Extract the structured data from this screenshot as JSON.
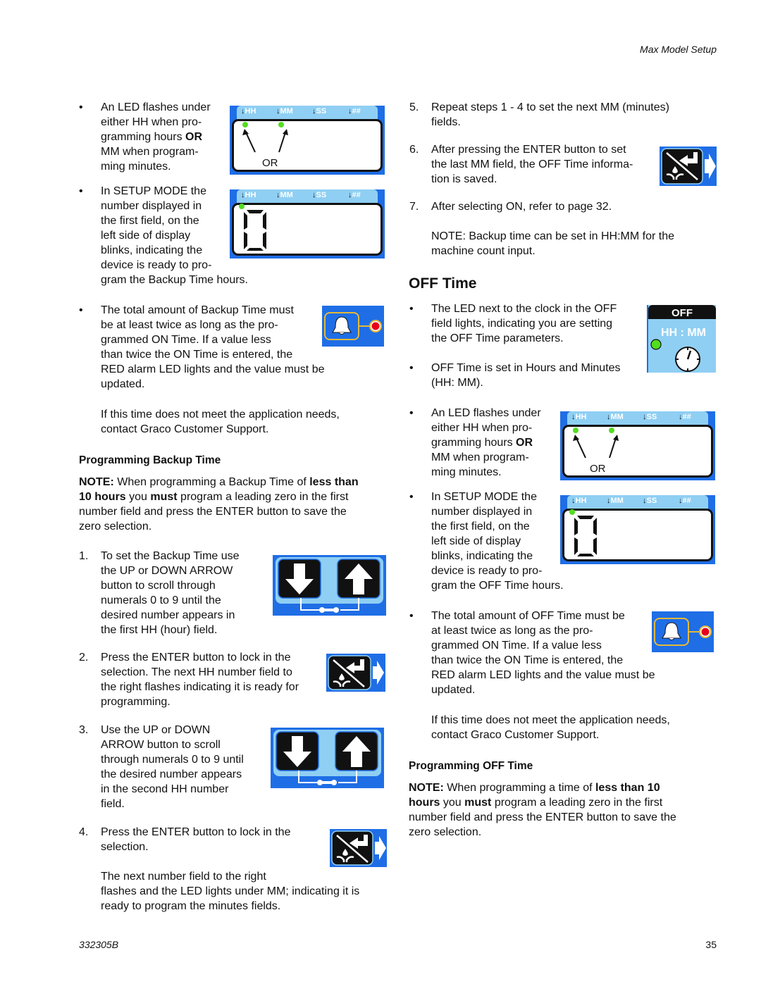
{
  "header": {
    "section": "Max Model Setup"
  },
  "footer": {
    "doc_number": "332305B",
    "page_number": "35"
  },
  "left": {
    "bullet1": {
      "lines": [
        "An LED flashes under",
        "either HH when pro-",
        "gramming hours ",
        "MM when program-",
        "ming minutes."
      ],
      "bold_or": "OR"
    },
    "bullet2": {
      "lines": [
        "In SETUP MODE the",
        "number displayed in",
        "the first field, on the",
        "left side of display",
        "blinks, indicating the",
        "device is ready to pro-",
        "gram the Backup Time hours."
      ]
    },
    "bullet3": {
      "lines": [
        "The total amount of Backup Time must",
        "be at least twice as long as the pro-",
        "grammed ON Time. If a value less",
        "than twice the ON Time is entered, the",
        "RED alarm LED lights and the value must be",
        "updated."
      ]
    },
    "contact_note": [
      "If this time does not meet the application needs,",
      "contact Graco Customer Support."
    ],
    "programming_heading": "Programming Backup Time",
    "note": {
      "label": "NOTE:",
      "t1": " When programming a Backup Time of ",
      "b1": "less than",
      "b2": "10 hours",
      "t2": " you ",
      "b3": "must",
      "t3": " program a leading zero in the first",
      "line3": "number field and press the ENTER button to save the",
      "line4": "zero selection."
    },
    "steps": [
      {
        "num": "1.",
        "lines": [
          "To set the Backup Time use",
          "the UP or DOWN ARROW",
          "button to scroll through",
          "numerals 0 to 9 until the",
          "desired number appears in",
          "the first HH (hour) field."
        ]
      },
      {
        "num": "2.",
        "lines": [
          "Press the ENTER button to lock in the",
          "selection. The next HH number field to",
          "the right flashes indicating it is ready for",
          "programming."
        ]
      },
      {
        "num": "3.",
        "lines": [
          "Use the UP or DOWN",
          "ARROW button to scroll",
          "through numerals 0 to 9 until",
          "the desired number appears",
          "in the second HH number",
          "field."
        ]
      },
      {
        "num": "4.",
        "lines": [
          "Press the ENTER button to lock in the",
          "selection."
        ]
      }
    ],
    "step4_followup": [
      "The next number field to the right",
      "flashes and the LED lights under MM; indicating it is",
      "ready to program the minutes fields."
    ]
  },
  "right": {
    "steps": [
      {
        "num": "5.",
        "lines": [
          "Repeat steps 1 - 4 to set the next MM (minutes)",
          "fields."
        ]
      },
      {
        "num": "6.",
        "lines": [
          "After pressing the ENTER button to set",
          "the last MM field, the OFF Time informa-",
          "tion is saved."
        ]
      },
      {
        "num": "7.",
        "lines": [
          "After selecting ON, refer to page 32."
        ]
      }
    ],
    "note_backup": [
      "NOTE: Backup time can be set in HH:MM for the",
      "machine count input."
    ],
    "off_heading": "OFF Time",
    "bullet1": {
      "lines": [
        "The LED next to the clock in the OFF",
        "field lights, indicating you are setting",
        "the OFF Time parameters."
      ]
    },
    "bullet2": {
      "lines": [
        "OFF Time is set in Hours and Minutes",
        "(HH: MM)."
      ]
    },
    "bullet3": {
      "lines": [
        "An LED flashes under",
        "either HH when pro-",
        "gramming hours ",
        "MM when program-",
        "ming minutes."
      ],
      "bold_or": "OR"
    },
    "bullet4": {
      "lines": [
        "In SETUP MODE the",
        "number displayed in",
        "the first field, on the",
        "left side of display",
        "blinks, indicating the",
        "device is ready to pro-",
        "gram the OFF Time hours."
      ]
    },
    "bullet5": {
      "lines": [
        "The total amount of OFF Time must be",
        "at least twice as long as the pro-",
        "grammed ON Time. If a value less",
        "than twice the ON Time is entered, the",
        "RED alarm LED lights and the value must be",
        "updated."
      ]
    },
    "contact_note": [
      "If this time does not meet the application needs,",
      "contact Graco Customer Support."
    ],
    "programming_heading": "Programming OFF Time",
    "note": {
      "label": "NOTE:",
      "t1": " When programming a time of ",
      "b1": "less than 10",
      "b2": "hours",
      "t2": " you ",
      "b3": "must",
      "t3": " program a leading zero in the first",
      "line3": "number field and press the ENTER button to save the",
      "line4": "zero selection."
    }
  },
  "display": {
    "labels": [
      "HH",
      "MM",
      "SS",
      "##"
    ],
    "or_text": "OR",
    "digit": "0",
    "off_label": "OFF",
    "hhmm_label": "HH : MM"
  },
  "bullet_char": "•",
  "colors": {
    "panel_blue": "#1f6ee6",
    "band_blue": "#8fcff3",
    "led_green": "#52dd1f",
    "alarm_red": "#e8001c",
    "bell_outline": "#e6b838"
  }
}
